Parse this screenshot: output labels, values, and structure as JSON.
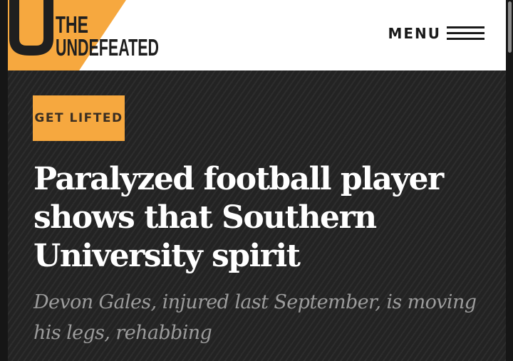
{
  "brand": {
    "line1": "THE",
    "line2": "UNDEFEATED",
    "accent_color": "#f6a83f"
  },
  "header": {
    "menu_label": "MENU",
    "menu_icon": "hamburger-icon"
  },
  "article": {
    "tag": "GET LIFTED",
    "headline": "Paralyzed football player shows that Southern University spirit",
    "subhead": "Devon Gales, injured last September, is moving his legs, rehabbing"
  }
}
